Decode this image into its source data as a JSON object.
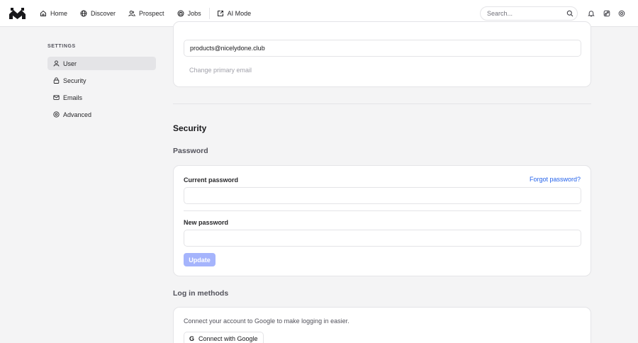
{
  "nav": {
    "items": [
      {
        "label": "Home",
        "icon": "home-icon"
      },
      {
        "label": "Discover",
        "icon": "globe-icon"
      },
      {
        "label": "Prospect",
        "icon": "users-icon"
      },
      {
        "label": "Jobs",
        "icon": "briefcase-icon"
      },
      {
        "label": "AI Mode",
        "icon": "external-link-icon"
      }
    ],
    "search_placeholder": "Search..."
  },
  "sidebar": {
    "heading": "SETTINGS",
    "items": [
      {
        "label": "User",
        "icon": "user-icon",
        "active": true
      },
      {
        "label": "Security",
        "icon": "lock-icon",
        "active": false
      },
      {
        "label": "Emails",
        "icon": "mail-icon",
        "active": false
      },
      {
        "label": "Advanced",
        "icon": "settings-icon",
        "active": false
      }
    ]
  },
  "email_card": {
    "email_value": "products@nicelydone.club",
    "change_primary_label": "Change primary email"
  },
  "security": {
    "title": "Security",
    "password_heading": "Password",
    "current_password_label": "Current password",
    "forgot_label": "Forgot password?",
    "new_password_label": "New password",
    "update_label": "Update"
  },
  "login_methods": {
    "heading": "Log in methods",
    "description": "Connect your account to Google to make logging in easier.",
    "connect_label": "Connect with Google",
    "google_glyph": "G"
  },
  "colors": {
    "accent": "#a5b4fc",
    "link": "#2563eb",
    "background": "#f4f4f5"
  }
}
